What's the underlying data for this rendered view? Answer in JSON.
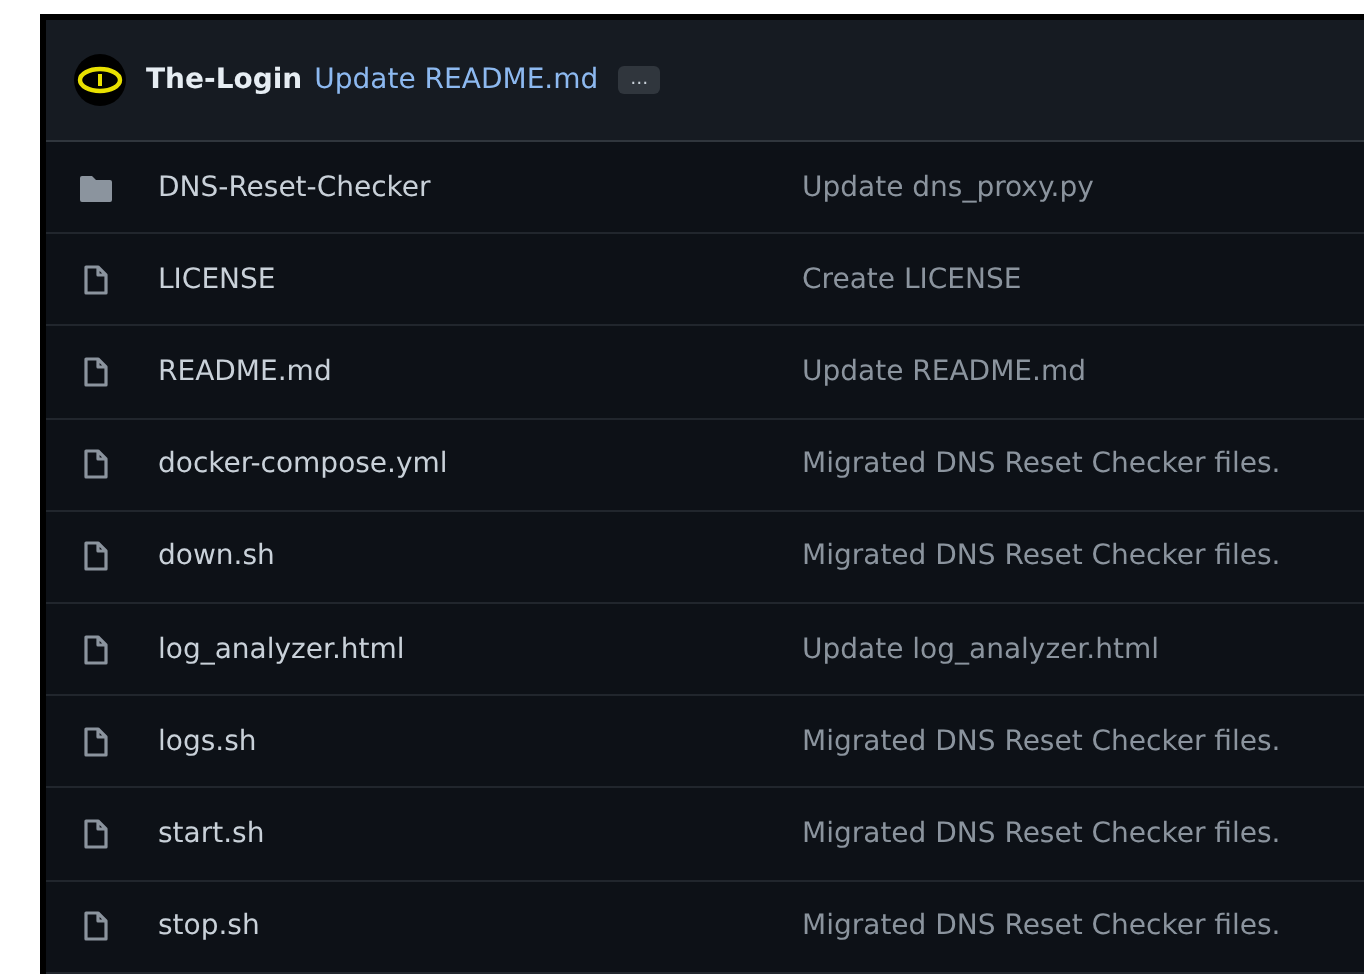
{
  "header": {
    "author": "The-Login",
    "message": "Update README.md",
    "more_button": "…"
  },
  "files": [
    {
      "kind": "folder",
      "name": "DNS-Reset-Checker",
      "commit": "Update dns_proxy.py"
    },
    {
      "kind": "file",
      "name": "LICENSE",
      "commit": "Create LICENSE"
    },
    {
      "kind": "file",
      "name": "README.md",
      "commit": "Update README.md"
    },
    {
      "kind": "file",
      "name": "docker-compose.yml",
      "commit": "Migrated DNS Reset Checker files."
    },
    {
      "kind": "file",
      "name": "down.sh",
      "commit": "Migrated DNS Reset Checker files."
    },
    {
      "kind": "file",
      "name": "log_analyzer.html",
      "commit": "Update log_analyzer.html"
    },
    {
      "kind": "file",
      "name": "logs.sh",
      "commit": "Migrated DNS Reset Checker files."
    },
    {
      "kind": "file",
      "name": "start.sh",
      "commit": "Migrated DNS Reset Checker files."
    },
    {
      "kind": "file",
      "name": "stop.sh",
      "commit": "Migrated DNS Reset Checker files."
    }
  ]
}
